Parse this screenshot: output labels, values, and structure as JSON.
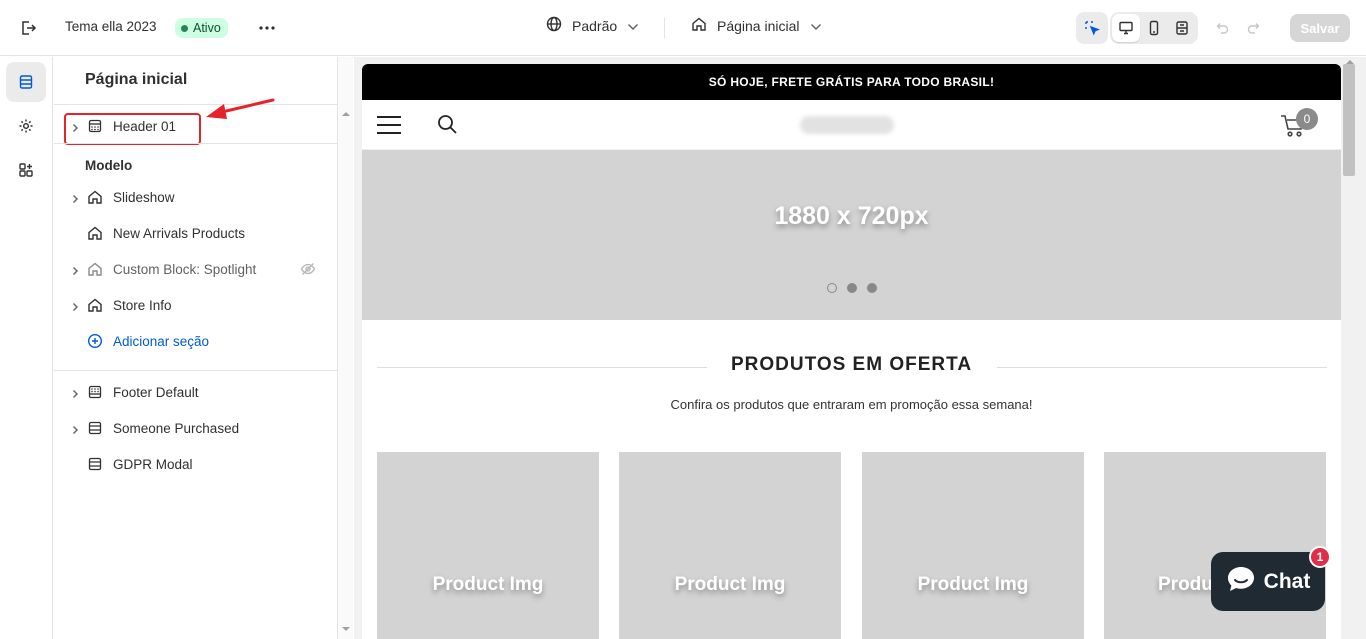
{
  "topbar": {
    "theme_name": "Tema ella 2023",
    "status_badge": "Ativo",
    "template_selector": "Padrão",
    "page_selector": "Página inicial",
    "save_label": "Salvar"
  },
  "panel": {
    "title": "Página inicial",
    "header_items": [
      {
        "label": "Header 01",
        "expandable": true
      }
    ],
    "template_label": "Modelo",
    "template_items": [
      {
        "label": "Slideshow",
        "expandable": true,
        "hidden": false
      },
      {
        "label": "New Arrivals Products",
        "expandable": false,
        "hidden": false
      },
      {
        "label": "Custom Block: Spotlight",
        "expandable": true,
        "hidden": true
      },
      {
        "label": "Store Info",
        "expandable": true,
        "hidden": false
      }
    ],
    "add_section_label": "Adicionar seção",
    "footer_items": [
      {
        "label": "Footer Default",
        "expandable": true
      },
      {
        "label": "Someone Purchased",
        "expandable": true
      },
      {
        "label": "GDPR Modal",
        "expandable": false
      }
    ]
  },
  "preview": {
    "announcement": "SÓ HOJE, FRETE GRÁTIS PARA TODO BRASIL!",
    "cart_count": "0",
    "hero_text": "1880 x 720px",
    "section_title": "PRODUTOS EM OFERTA",
    "section_subtitle": "Confira os produtos que entraram em promoção essa semana!",
    "product_cards": [
      "Product Img",
      "Product Img",
      "Product Img",
      "Product Img"
    ]
  },
  "chat": {
    "label": "Chat",
    "badge": "1"
  },
  "colors": {
    "accent_blue": "#005bd3",
    "highlight_red": "#e5232b",
    "badge_green_bg": "#cdfee1",
    "chat_bg": "#1f2a33"
  }
}
